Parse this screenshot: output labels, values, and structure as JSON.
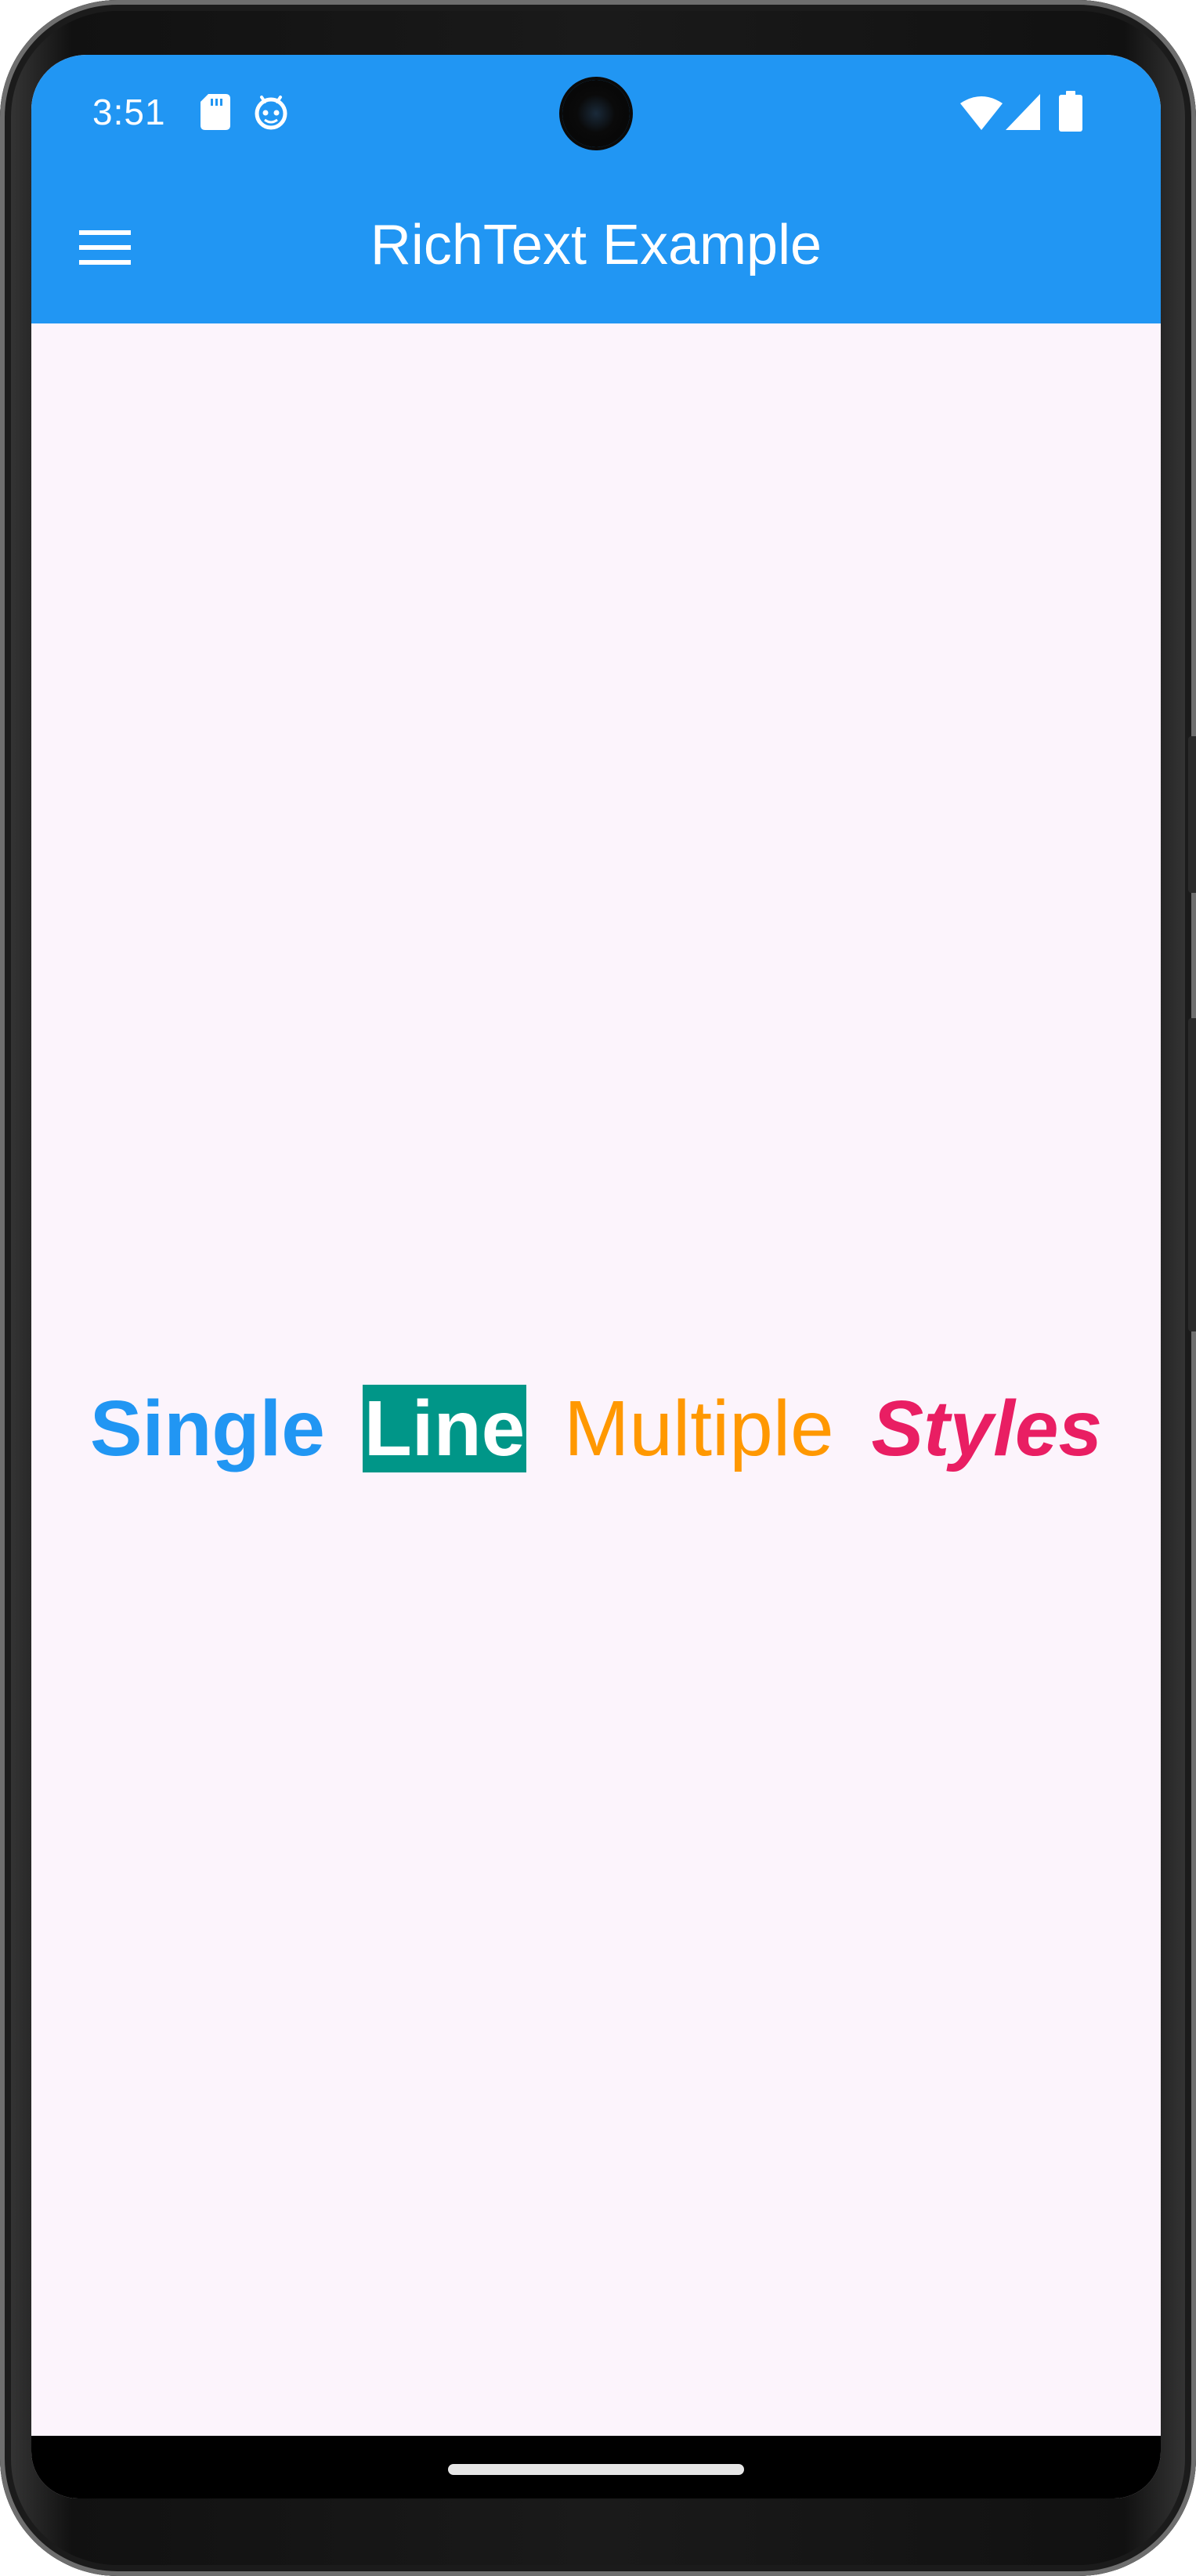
{
  "status_bar": {
    "time": "3:51",
    "icons": [
      "sd-card-icon",
      "debug-icon",
      "wifi-icon",
      "signal-icon",
      "battery-icon"
    ]
  },
  "app_bar": {
    "title": "RichText Example",
    "menu_icon": "menu-icon",
    "background_color": "#2196f3"
  },
  "content": {
    "background_color": "#fcf4fc",
    "rich_text": {
      "spans": [
        {
          "text": "Single",
          "color": "#2196f3",
          "weight": "bold"
        },
        {
          "text": "Line",
          "color": "#ffffff",
          "background": "#009688",
          "weight": "bold"
        },
        {
          "text": "Multiple",
          "color": "#ff9800",
          "weight": "normal"
        },
        {
          "text": "Styles",
          "color": "#e91e63",
          "weight": "bold",
          "style": "italic"
        }
      ]
    }
  },
  "nav_bar": {
    "home_indicator_icon": "home-indicator"
  }
}
